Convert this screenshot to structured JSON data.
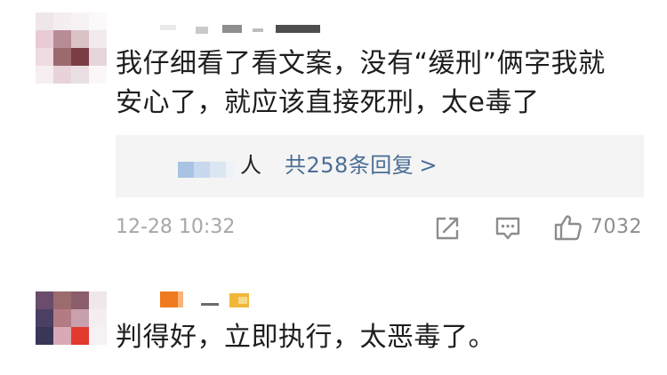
{
  "comments": [
    {
      "text_line1": "我仔细看了看文案，没有“缓刑”俩字我就",
      "text_line2": "安心了，就应该直接死刑，太e毒了",
      "reply_tail": "人",
      "reply_link": "共258条回复",
      "reply_arrow": ">",
      "timestamp": "12-28 10:32",
      "like_count": "7032"
    },
    {
      "text_line1": "判得好，立即执行，太恶毒了。"
    }
  ],
  "icons": [
    "share-icon",
    "comment-icon",
    "thumbs-up-icon"
  ],
  "colors": {
    "link": "#4a6e95",
    "meta_text": "#a7a7a7",
    "reply_bg": "#f4f4f4",
    "icon": "#8d8d8d"
  }
}
